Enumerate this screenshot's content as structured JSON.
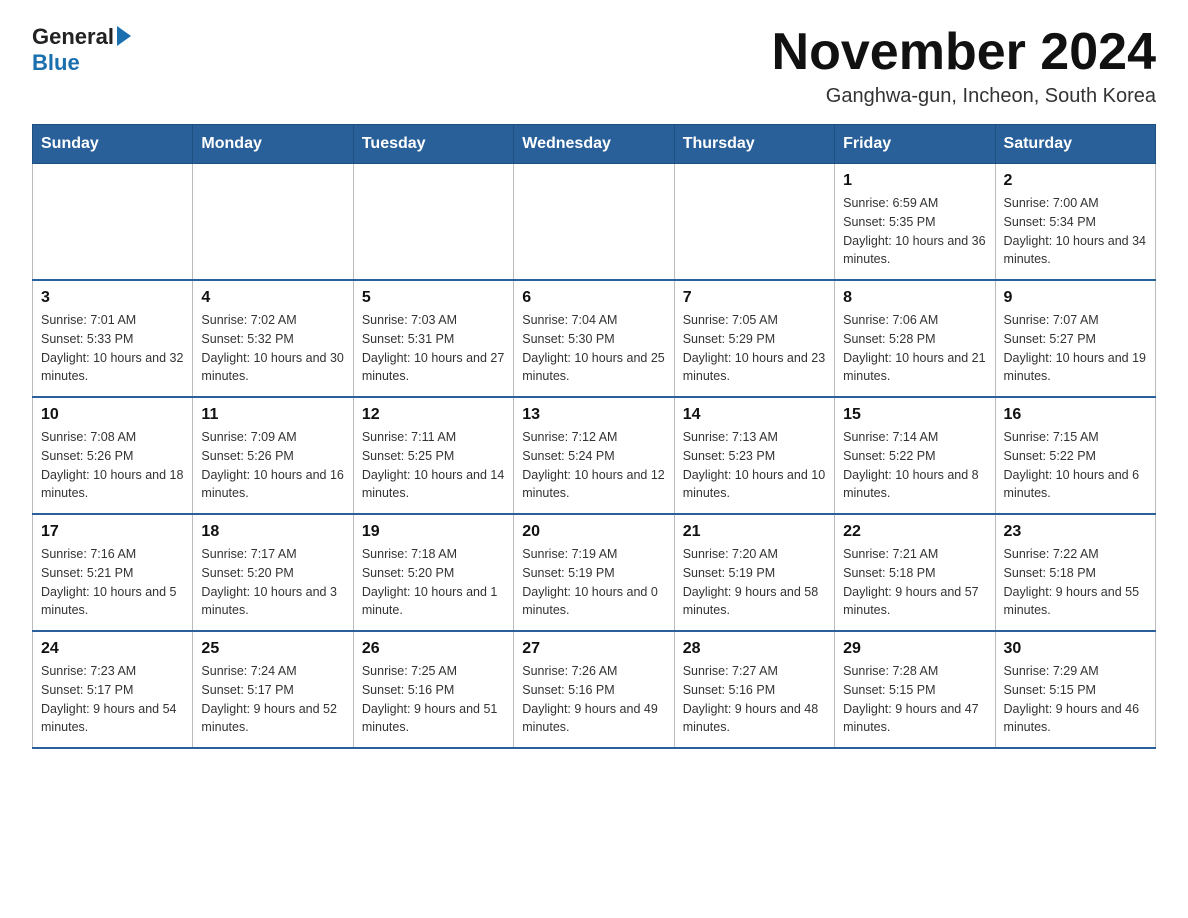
{
  "header": {
    "logo_general": "General",
    "logo_blue": "Blue",
    "month_title": "November 2024",
    "location": "Ganghwa-gun, Incheon, South Korea"
  },
  "weekdays": [
    "Sunday",
    "Monday",
    "Tuesday",
    "Wednesday",
    "Thursday",
    "Friday",
    "Saturday"
  ],
  "weeks": [
    [
      {
        "day": "",
        "info": ""
      },
      {
        "day": "",
        "info": ""
      },
      {
        "day": "",
        "info": ""
      },
      {
        "day": "",
        "info": ""
      },
      {
        "day": "",
        "info": ""
      },
      {
        "day": "1",
        "info": "Sunrise: 6:59 AM\nSunset: 5:35 PM\nDaylight: 10 hours and 36 minutes."
      },
      {
        "day": "2",
        "info": "Sunrise: 7:00 AM\nSunset: 5:34 PM\nDaylight: 10 hours and 34 minutes."
      }
    ],
    [
      {
        "day": "3",
        "info": "Sunrise: 7:01 AM\nSunset: 5:33 PM\nDaylight: 10 hours and 32 minutes."
      },
      {
        "day": "4",
        "info": "Sunrise: 7:02 AM\nSunset: 5:32 PM\nDaylight: 10 hours and 30 minutes."
      },
      {
        "day": "5",
        "info": "Sunrise: 7:03 AM\nSunset: 5:31 PM\nDaylight: 10 hours and 27 minutes."
      },
      {
        "day": "6",
        "info": "Sunrise: 7:04 AM\nSunset: 5:30 PM\nDaylight: 10 hours and 25 minutes."
      },
      {
        "day": "7",
        "info": "Sunrise: 7:05 AM\nSunset: 5:29 PM\nDaylight: 10 hours and 23 minutes."
      },
      {
        "day": "8",
        "info": "Sunrise: 7:06 AM\nSunset: 5:28 PM\nDaylight: 10 hours and 21 minutes."
      },
      {
        "day": "9",
        "info": "Sunrise: 7:07 AM\nSunset: 5:27 PM\nDaylight: 10 hours and 19 minutes."
      }
    ],
    [
      {
        "day": "10",
        "info": "Sunrise: 7:08 AM\nSunset: 5:26 PM\nDaylight: 10 hours and 18 minutes."
      },
      {
        "day": "11",
        "info": "Sunrise: 7:09 AM\nSunset: 5:26 PM\nDaylight: 10 hours and 16 minutes."
      },
      {
        "day": "12",
        "info": "Sunrise: 7:11 AM\nSunset: 5:25 PM\nDaylight: 10 hours and 14 minutes."
      },
      {
        "day": "13",
        "info": "Sunrise: 7:12 AM\nSunset: 5:24 PM\nDaylight: 10 hours and 12 minutes."
      },
      {
        "day": "14",
        "info": "Sunrise: 7:13 AM\nSunset: 5:23 PM\nDaylight: 10 hours and 10 minutes."
      },
      {
        "day": "15",
        "info": "Sunrise: 7:14 AM\nSunset: 5:22 PM\nDaylight: 10 hours and 8 minutes."
      },
      {
        "day": "16",
        "info": "Sunrise: 7:15 AM\nSunset: 5:22 PM\nDaylight: 10 hours and 6 minutes."
      }
    ],
    [
      {
        "day": "17",
        "info": "Sunrise: 7:16 AM\nSunset: 5:21 PM\nDaylight: 10 hours and 5 minutes."
      },
      {
        "day": "18",
        "info": "Sunrise: 7:17 AM\nSunset: 5:20 PM\nDaylight: 10 hours and 3 minutes."
      },
      {
        "day": "19",
        "info": "Sunrise: 7:18 AM\nSunset: 5:20 PM\nDaylight: 10 hours and 1 minute."
      },
      {
        "day": "20",
        "info": "Sunrise: 7:19 AM\nSunset: 5:19 PM\nDaylight: 10 hours and 0 minutes."
      },
      {
        "day": "21",
        "info": "Sunrise: 7:20 AM\nSunset: 5:19 PM\nDaylight: 9 hours and 58 minutes."
      },
      {
        "day": "22",
        "info": "Sunrise: 7:21 AM\nSunset: 5:18 PM\nDaylight: 9 hours and 57 minutes."
      },
      {
        "day": "23",
        "info": "Sunrise: 7:22 AM\nSunset: 5:18 PM\nDaylight: 9 hours and 55 minutes."
      }
    ],
    [
      {
        "day": "24",
        "info": "Sunrise: 7:23 AM\nSunset: 5:17 PM\nDaylight: 9 hours and 54 minutes."
      },
      {
        "day": "25",
        "info": "Sunrise: 7:24 AM\nSunset: 5:17 PM\nDaylight: 9 hours and 52 minutes."
      },
      {
        "day": "26",
        "info": "Sunrise: 7:25 AM\nSunset: 5:16 PM\nDaylight: 9 hours and 51 minutes."
      },
      {
        "day": "27",
        "info": "Sunrise: 7:26 AM\nSunset: 5:16 PM\nDaylight: 9 hours and 49 minutes."
      },
      {
        "day": "28",
        "info": "Sunrise: 7:27 AM\nSunset: 5:16 PM\nDaylight: 9 hours and 48 minutes."
      },
      {
        "day": "29",
        "info": "Sunrise: 7:28 AM\nSunset: 5:15 PM\nDaylight: 9 hours and 47 minutes."
      },
      {
        "day": "30",
        "info": "Sunrise: 7:29 AM\nSunset: 5:15 PM\nDaylight: 9 hours and 46 minutes."
      }
    ]
  ]
}
